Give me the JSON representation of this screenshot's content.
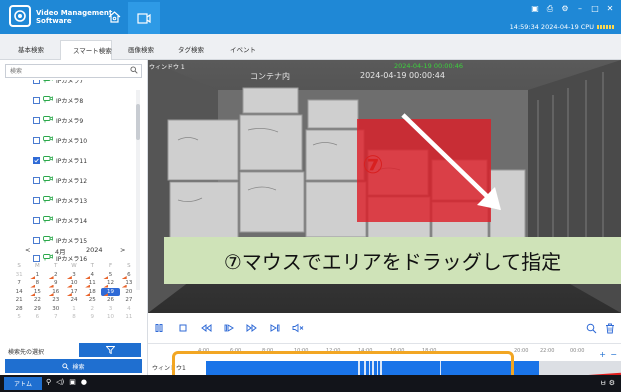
{
  "app": {
    "title_line1": "Video Management",
    "title_line2": "Software",
    "status_time": "14:59:34 2024-04-19 CPU",
    "win_controls": [
      "▣",
      "⎙",
      "⚙",
      "–",
      "□",
      "✕"
    ]
  },
  "tabs": [
    "基本検索",
    "スマート検索",
    "画像検索",
    "タグ検索",
    "イベント"
  ],
  "active_tab": "スマート検索",
  "search": {
    "placeholder": "検索"
  },
  "camera_list": [
    {
      "label": "IPカメラ7",
      "checked": false
    },
    {
      "label": "IPカメラ8",
      "checked": false
    },
    {
      "label": "IPカメラ9",
      "checked": false
    },
    {
      "label": "IPカメラ10",
      "checked": false
    },
    {
      "label": "IPカメラ11",
      "checked": true
    },
    {
      "label": "IPカメラ12",
      "checked": false
    },
    {
      "label": "IPカメラ13",
      "checked": false
    },
    {
      "label": "IPカメラ14",
      "checked": false
    },
    {
      "label": "IPカメラ15",
      "checked": false
    },
    {
      "label": "IPカメラ16",
      "checked": false
    }
  ],
  "calendar": {
    "prev": "<",
    "next": ">",
    "month": "4月",
    "year": "2024",
    "weekdays": [
      "S",
      "M",
      "T",
      "W",
      "T",
      "F",
      "S"
    ],
    "weeks": [
      [
        "31",
        "1",
        "2",
        "3",
        "4",
        "5",
        "6"
      ],
      [
        "7",
        "8",
        "9",
        "10",
        "11",
        "12",
        "13"
      ],
      [
        "14",
        "15",
        "16",
        "17",
        "18",
        "19",
        "20"
      ],
      [
        "21",
        "22",
        "23",
        "24",
        "25",
        "26",
        "27"
      ],
      [
        "28",
        "29",
        "30",
        "1",
        "2",
        "3",
        "4"
      ],
      [
        "5",
        "6",
        "7",
        "8",
        "9",
        "10",
        "11"
      ]
    ],
    "selected": "19",
    "marked_days": [
      "1",
      "2",
      "3",
      "4",
      "5",
      "6",
      "8",
      "9",
      "10",
      "11",
      "12",
      "13",
      "15",
      "16",
      "17",
      "18",
      "19"
    ]
  },
  "search_target_label": "検索先の選択",
  "search_button_label": "検索",
  "video": {
    "window_label": "ウィンドウ 1",
    "green_timestamp": "2024-04-19 00:00:46",
    "osd_camera": "コンテナ内",
    "osd_time": "2024-04-19 00:00:44",
    "step_number": "⑦",
    "caption": "⑦マウスでエリアをドラッグして指定"
  },
  "timeline": {
    "row_label": "ウィンドウ1",
    "tick_labels": [
      "4:00",
      "6:00",
      "8:00",
      "10:00",
      "12:00",
      "14:00",
      "16:00",
      "18:00",
      "20:00",
      "22:00",
      "00:00"
    ],
    "plus": "+",
    "minus": "−"
  },
  "taskbar": {
    "app_label": "アトム",
    "tray_text": "ㅂ ⚙"
  },
  "colors": {
    "titlebar": "#1f88d6",
    "accent": "#1f6fd0",
    "highlight": "#f2a623",
    "caption_bg": "#cfe3b8"
  }
}
